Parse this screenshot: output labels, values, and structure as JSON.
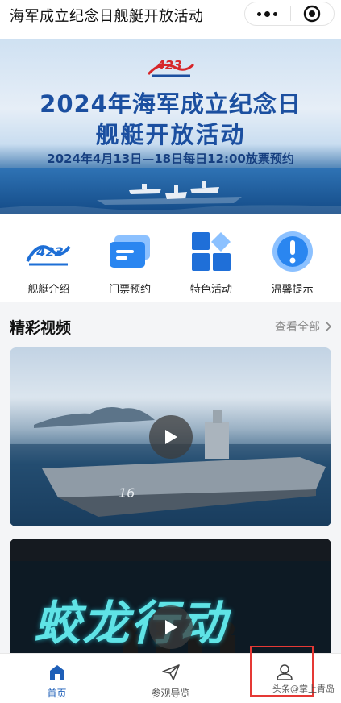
{
  "window": {
    "title": "海军成立纪念日舰艇开放活动"
  },
  "banner": {
    "logo_text": "423",
    "headline_1": "2024年海军成立纪念日",
    "headline_2": "舰艇开放活动",
    "date_line": "2024年4月13日—18日每日12:00放票预约"
  },
  "shortcuts": [
    {
      "label": "舰艇介绍",
      "icon": "navy-logo-icon"
    },
    {
      "label": "门票预约",
      "icon": "ticket-icon"
    },
    {
      "label": "特色活动",
      "icon": "blocks-icon"
    },
    {
      "label": "温馨提示",
      "icon": "exclamation-icon"
    }
  ],
  "videos_section": {
    "title": "精彩视频",
    "view_all": "查看全部"
  },
  "videos": [
    {
      "overlay_text": "16"
    },
    {
      "overlay_text": "蛟龙行动"
    }
  ],
  "tabbar": {
    "tabs": [
      {
        "label": "首页",
        "icon": "home-icon",
        "active": true
      },
      {
        "label": "参观导览",
        "icon": "paper-plane-icon",
        "active": false
      },
      {
        "label": "",
        "icon": "user-icon",
        "active": false
      }
    ]
  },
  "watermark": "头条@掌上青岛",
  "colors": {
    "accent": "#1e5fb8",
    "highlight": "#e53935",
    "banner_title": "#1b4fa0"
  }
}
